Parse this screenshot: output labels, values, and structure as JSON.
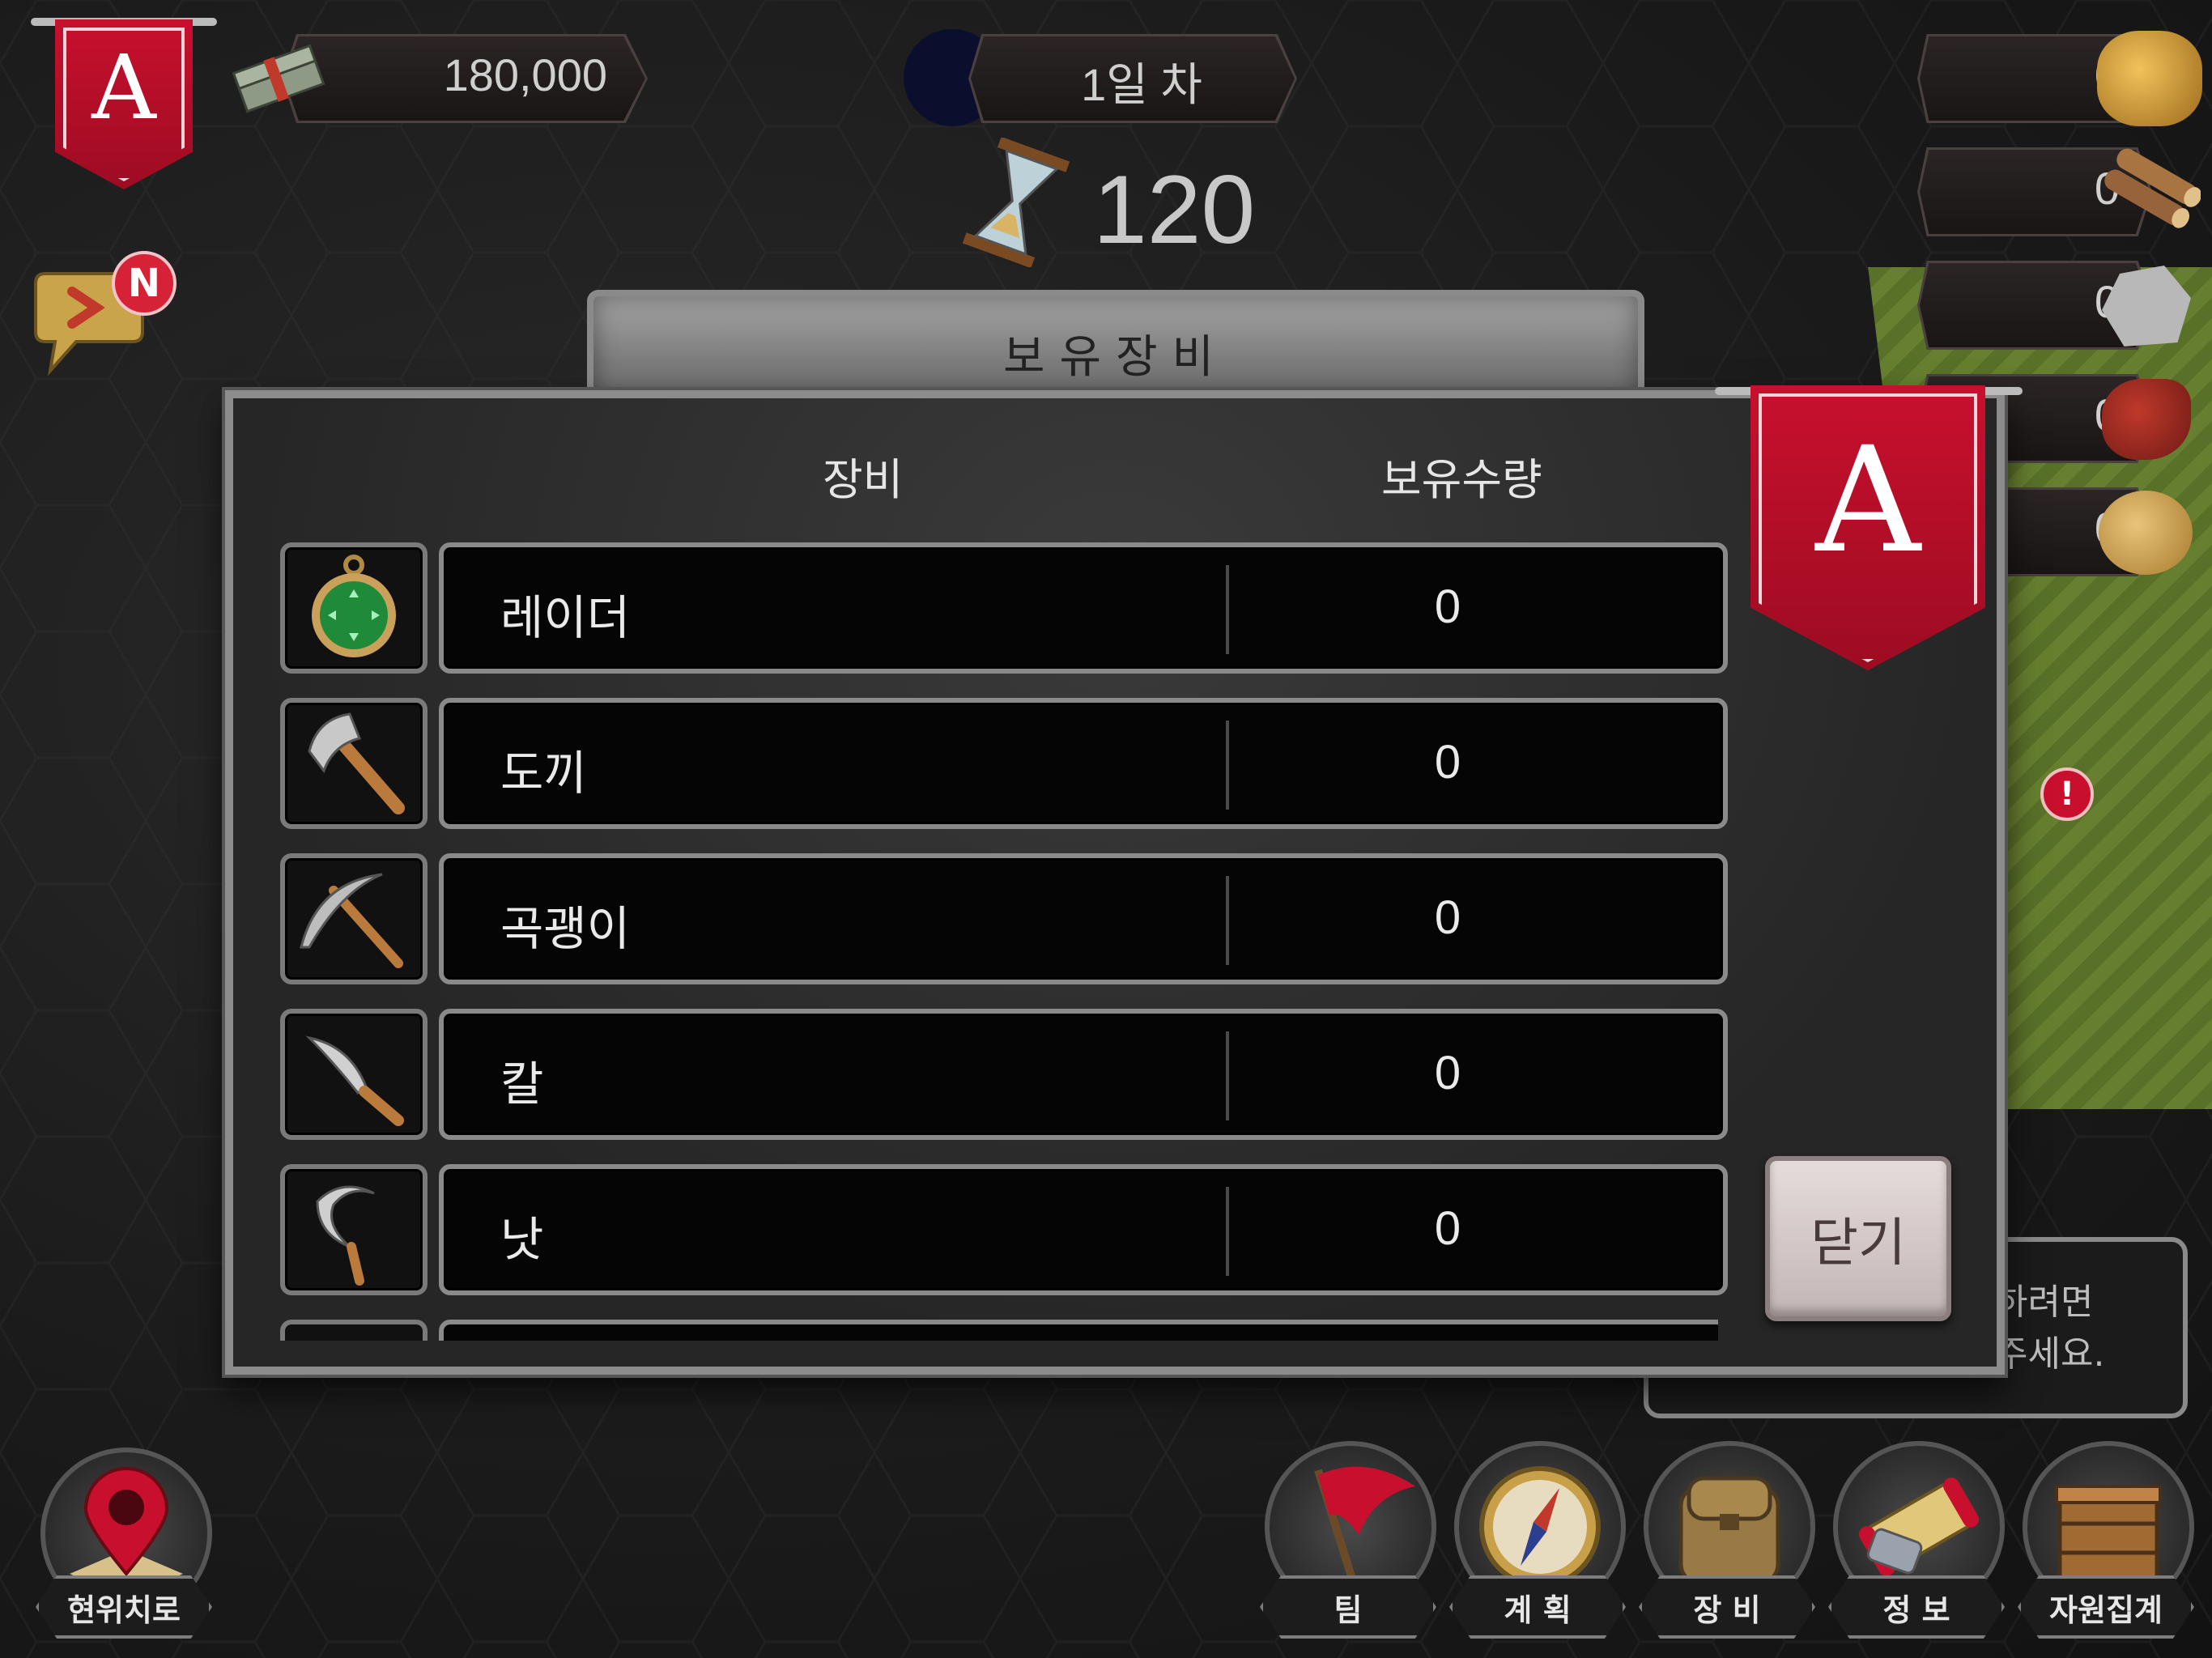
{
  "top_bar": {
    "money_value": "180,000",
    "day_label": "1일 차",
    "turns_value": "120",
    "team_letter": "A"
  },
  "resources": [
    {
      "name": "gold-ore",
      "value": "0"
    },
    {
      "name": "wood",
      "value": "0"
    },
    {
      "name": "stone",
      "value": "0"
    },
    {
      "name": "meat",
      "value": "0"
    },
    {
      "name": "grain",
      "value": "0"
    }
  ],
  "chat": {
    "badge": "N"
  },
  "panel": {
    "title": "보유장비",
    "header_item": "장비",
    "header_count": "보유수량",
    "banner_letter": "A",
    "items": [
      {
        "name": "레이더",
        "count": "0",
        "icon": "radar-icon"
      },
      {
        "name": "도끼",
        "count": "0",
        "icon": "axe-icon"
      },
      {
        "name": "곡괭이",
        "count": "0",
        "icon": "pickaxe-icon"
      },
      {
        "name": "칼",
        "count": "0",
        "icon": "knife-icon"
      },
      {
        "name": "낫",
        "count": "0",
        "icon": "sickle-icon"
      }
    ],
    "close_label": "닫기"
  },
  "hint": {
    "line1": "하려면",
    "line2": "주세요."
  },
  "bottom_nav": {
    "locate_label": "현위치로",
    "team_label": "팀",
    "plan_label": "계 획",
    "equip_label": "장 비",
    "info_label": "정 보",
    "resource_label": "자원집계"
  },
  "colors": {
    "banner_red": "#c8102e",
    "panel_border": "#8c8c8c",
    "background": "#1a1a1a"
  }
}
